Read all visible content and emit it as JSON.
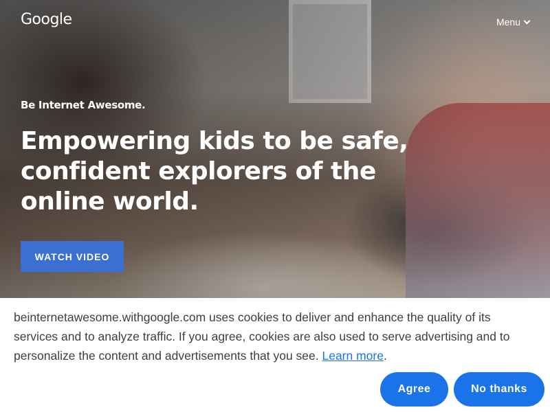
{
  "header": {
    "logo_text": "Google",
    "menu_label": "Menu"
  },
  "hero": {
    "brand": "Be Internet Awesome.",
    "headline": "Empowering kids to be safe, confident explorers of the online world.",
    "watch_video_label": "WATCH VIDEO"
  },
  "cookie_banner": {
    "text": "beinternetawesome.withgoogle.com uses cookies to deliver and enhance the quality of its services and to analyze traffic. If you agree, cookies are also used to serve advertising and to personalize the content and advertisements that you see. ",
    "learn_more": "Learn more",
    "period": ".",
    "agree_label": "Agree",
    "no_thanks_label": "No thanks"
  },
  "icons": {
    "menu_chevron": "chevron-down-icon"
  },
  "colors": {
    "primary_button": "#1a73e8",
    "watch_button": "#3b6fd4",
    "banner_text": "#3c4043"
  }
}
